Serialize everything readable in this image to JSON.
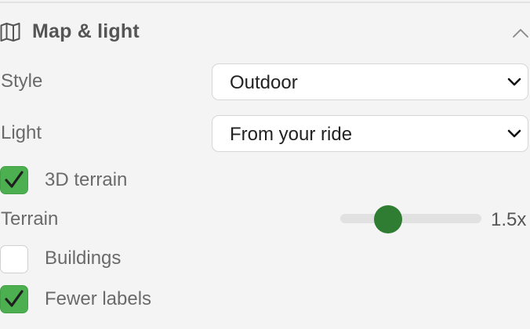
{
  "section": {
    "title": "Map & light",
    "icon": "map-icon",
    "collapse_icon": "chevron-up-icon"
  },
  "style": {
    "label": "Style",
    "value": "Outdoor"
  },
  "light": {
    "label": "Light",
    "value": "From your ride"
  },
  "terrain_3d": {
    "label": "3D terrain",
    "checked": true
  },
  "terrain_exaggeration": {
    "label": "Terrain",
    "value_text": "1.5x",
    "level_fraction": 0.3
  },
  "buildings": {
    "label": "Buildings",
    "checked": false
  },
  "fewer_labels": {
    "label": "Fewer labels",
    "checked": true
  },
  "colors": {
    "checkbox_checked": "#4caf50",
    "slider_thumb": "#2e7d32",
    "background": "#f4f4f4"
  }
}
